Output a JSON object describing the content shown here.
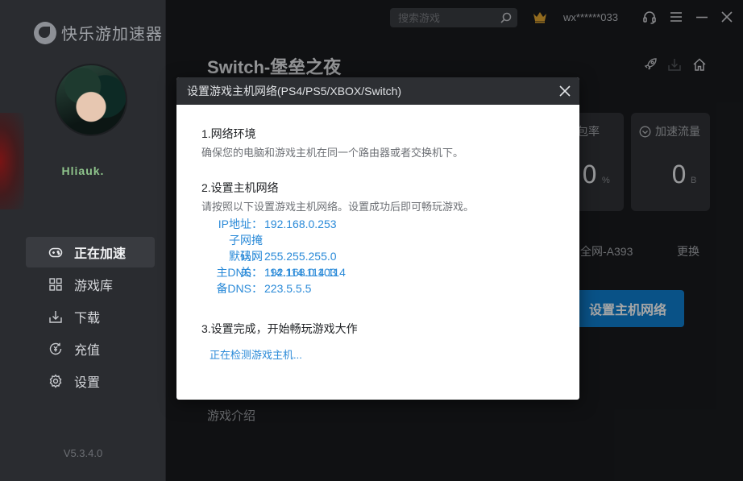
{
  "app": {
    "logo_text": "快乐游加速器",
    "username": "Hliauk.",
    "version": "V5.3.4.0"
  },
  "sidebar": {
    "items": [
      {
        "label": "正在加速",
        "icon": "gamepad-icon",
        "active": true
      },
      {
        "label": "游戏库",
        "icon": "grid-icon",
        "active": false
      },
      {
        "label": "下载",
        "icon": "download-icon",
        "active": false
      },
      {
        "label": "充值",
        "icon": "recharge-icon",
        "active": false
      },
      {
        "label": "设置",
        "icon": "gear-icon",
        "active": false
      }
    ]
  },
  "topbar": {
    "search_placeholder": "搜索游戏",
    "user_id": "wx******033"
  },
  "main": {
    "game_title": "Switch-堡垒之夜",
    "stats": [
      {
        "label": "包率",
        "value": "0",
        "unit": "%"
      },
      {
        "label": "加速流量",
        "value": "0",
        "unit": "B"
      }
    ],
    "server_name": "全网-A393",
    "change_label": "更换",
    "setup_button": "设置主机网络",
    "intro_label": "游戏介绍"
  },
  "modal": {
    "title": "设置游戏主机网络(PS4/PS5/XBOX/Switch)",
    "step1_title": "1.网络环境",
    "step1_desc": "确保您的电脑和游戏主机在同一个路由器或者交换机下。",
    "step2_title": "2.设置主机网络",
    "step2_desc": "请按照以下设置游戏主机网络。设置成功后即可畅玩游戏。",
    "network": [
      {
        "label": "IP地址：",
        "value": "192.168.0.253"
      },
      {
        "label": "子网掩码：",
        "value": "255.255.255.0"
      },
      {
        "label": "默认网关：",
        "value": "192.168.0.103"
      },
      {
        "label": "主DNS：",
        "value": "114.114.114.114"
      },
      {
        "label": "备DNS：",
        "value": "223.5.5.5"
      }
    ],
    "step3_title": "3.设置完成，开始畅玩游戏大作",
    "detecting_text": "正在检测游戏主机..."
  },
  "colors": {
    "accent": "#0f7fd0",
    "link": "#2a8ad8",
    "sidebar_bg": "#2a2c30",
    "main_bg": "#1a1b1e"
  }
}
